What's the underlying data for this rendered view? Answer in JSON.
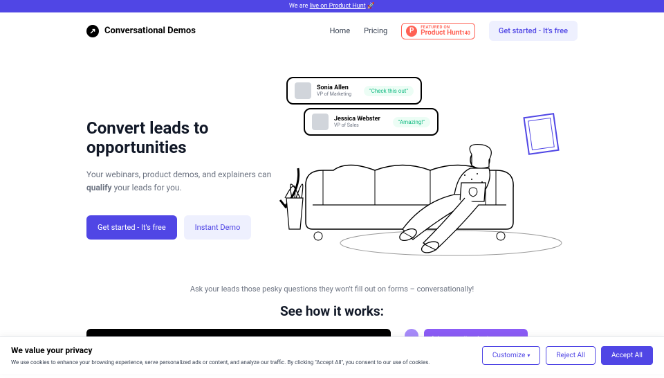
{
  "banner": {
    "prefix": "We are ",
    "link_text": "live on Product Hunt",
    "emoji": "🚀"
  },
  "brand": {
    "name": "Conversational Demos"
  },
  "nav": {
    "home": "Home",
    "pricing": "Pricing"
  },
  "ph_badge": {
    "featured": "FEATURED ON",
    "main": "Product Hunt",
    "count": "140"
  },
  "header_cta": "Get started - It's free",
  "hero": {
    "title": "Convert leads to opportunities",
    "subtitle_1": "Your webinars, product demos, and explainers can ",
    "subtitle_bold": "qualify",
    "subtitle_2": " your leads for you.",
    "primary": "Get started - It's free",
    "secondary": "Instant Demo"
  },
  "chat_cards": [
    {
      "name": "Sonia Allen",
      "role": "VP of Marketing",
      "bubble": "\"Check this out\""
    },
    {
      "name": "Jessica Webster",
      "role": "VP of Sales",
      "bubble": "\"Amazing!\""
    }
  ],
  "below": {
    "subtitle": "Ask your leads those pesky questions they won't fill out on forms – conversationally!",
    "title": "See how it works:",
    "ask_bubble": "Ask any question about Conversational Demos, and I'll show you the segment of the video with the answer."
  },
  "cookies": {
    "title": "We value your privacy",
    "text": "We use cookies to enhance your browsing experience, serve personalized ads or content, and analyze our traffic. By clicking \"Accept All\", you consent to our use of cookies.",
    "customize": "Customize",
    "reject": "Reject All",
    "accept": "Accept All"
  }
}
